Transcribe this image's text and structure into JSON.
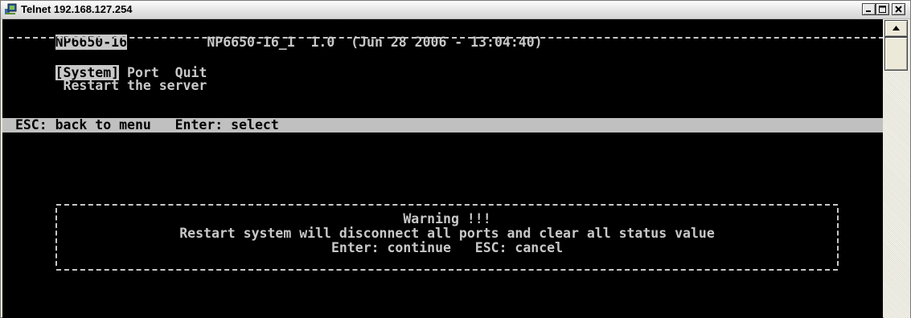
{
  "window": {
    "title": "Telnet 192.168.127.254",
    "icon": "telnet-app-icon"
  },
  "terminal": {
    "device_name": "NP6650-16",
    "header_info": "NP6650-16_1  1.0  (Jun 28 2006 - 13:04:40)",
    "menu": {
      "selected": "[System]",
      "items": [
        "Port",
        "Quit"
      ]
    },
    "menu_description": "Restart the server",
    "status_bar": "ESC: back to menu   Enter: select",
    "dialog": {
      "title": "Warning !!!",
      "message": "Restart system will disconnect all ports and clear all status value",
      "actions": "Enter: continue   ESC: cancel"
    }
  },
  "colors": {
    "terminal_bg": "#000000",
    "terminal_fg": "#c8c8c8",
    "status_bar_bg": "#c0c0c0"
  }
}
